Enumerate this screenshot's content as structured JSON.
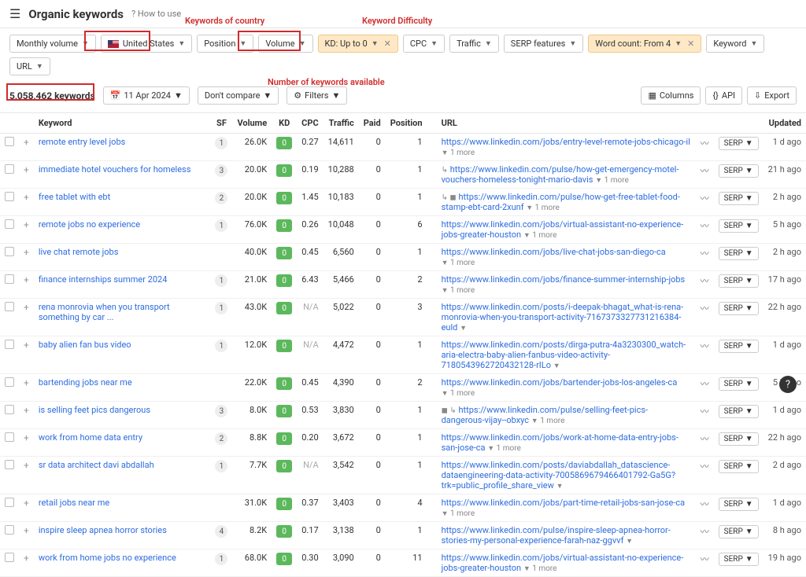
{
  "header": {
    "title": "Organic keywords",
    "how": "How to use"
  },
  "filters": {
    "volume_period": "Monthly volume",
    "country": "United States",
    "position": "Position",
    "volume": "Volume",
    "kd": "KD: Up to 0",
    "cpc": "CPC",
    "traffic": "Traffic",
    "serp": "SERP features",
    "wordcount": "Word count: From 4",
    "keyword": "Keyword",
    "url": "URL"
  },
  "bar": {
    "count": "5,058,462 keywords",
    "date": "11 Apr 2024",
    "compare": "Don't compare",
    "filters_btn": "Filters",
    "columns": "Columns",
    "api": "API",
    "export": "Export"
  },
  "cols": {
    "kw": "Keyword",
    "sf": "SF",
    "vol": "Volume",
    "kd": "KD",
    "cpc": "CPC",
    "traffic": "Traffic",
    "paid": "Paid",
    "pos": "Position",
    "url": "URL",
    "upd": "Updated",
    "serp": "SERP"
  },
  "more_label": "1 more",
  "annot": {
    "country": "Keywords of country",
    "kd": "Keyword Difficulty",
    "count": "Number of keywords available"
  },
  "rows": [
    {
      "kw": "remote entry level jobs",
      "sf": "1",
      "vol": "26.0K",
      "kd": "0",
      "cpc": "0.27",
      "traffic": "14,611",
      "paid": "0",
      "pos": "1",
      "url": "https://www.linkedin.com/jobs/entry-level-remote-jobs-chicago-il",
      "more": true,
      "upd": "1 d ago"
    },
    {
      "kw": "immediate hotel vouchers for homeless",
      "sf": "3",
      "vol": "20.0K",
      "kd": "0",
      "cpc": "0.19",
      "traffic": "10,288",
      "paid": "0",
      "pos": "1",
      "url": "https://www.linkedin.com/pulse/how-get-emergency-motel-vouchers-homeless-tonight-mario-davis",
      "more": true,
      "upd": "21 h ago",
      "pre": "↳"
    },
    {
      "kw": "free tablet with ebt",
      "sf": "2",
      "vol": "20.0K",
      "kd": "0",
      "cpc": "1.45",
      "traffic": "10,183",
      "paid": "0",
      "pos": "1",
      "url": "https://www.linkedin.com/pulse/how-get-free-tablet-food-stamp-ebt-card-2xunf",
      "more": true,
      "upd": "2 h ago",
      "pre": "↳ ◼"
    },
    {
      "kw": "remote jobs no experience",
      "sf": "1",
      "vol": "76.0K",
      "kd": "0",
      "cpc": "0.26",
      "traffic": "10,048",
      "paid": "0",
      "pos": "6",
      "url": "https://www.linkedin.com/jobs/virtual-assistant-no-experience-jobs-greater-houston",
      "more": true,
      "upd": "5 h ago"
    },
    {
      "kw": "live chat remote jobs",
      "sf": "",
      "vol": "40.0K",
      "kd": "0",
      "cpc": "0.45",
      "traffic": "6,560",
      "paid": "0",
      "pos": "1",
      "url": "https://www.linkedin.com/jobs/live-chat-jobs-san-diego-ca",
      "more": true,
      "upd": "2 h ago"
    },
    {
      "kw": "finance internships summer 2024",
      "sf": "1",
      "vol": "21.0K",
      "kd": "0",
      "cpc": "6.43",
      "traffic": "5,466",
      "paid": "0",
      "pos": "2",
      "url": "https://www.linkedin.com/jobs/finance-summer-internship-jobs",
      "more": true,
      "upd": "17 h ago"
    },
    {
      "kw": "rena monrovia when you transport something by car ...",
      "sf": "1",
      "vol": "43.0K",
      "kd": "0",
      "cpc": "N/A",
      "traffic": "5,022",
      "paid": "0",
      "pos": "3",
      "url": "https://www.linkedin.com/posts/i-deepak-bhagat_what-is-rena-monrovia-when-you-transport-activity-7167373327731216384-euld",
      "more": false,
      "upd": "22 h ago"
    },
    {
      "kw": "baby alien fan bus video",
      "sf": "1",
      "vol": "12.0K",
      "kd": "0",
      "cpc": "N/A",
      "traffic": "4,472",
      "paid": "0",
      "pos": "1",
      "url": "https://www.linkedin.com/posts/dirga-putra-4a3230300_watch-aria-electra-baby-alien-fanbus-video-activity-7180543962720432128-rILo",
      "more": false,
      "upd": "1 d ago"
    },
    {
      "kw": "bartending jobs near me",
      "sf": "",
      "vol": "22.0K",
      "kd": "0",
      "cpc": "0.45",
      "traffic": "4,390",
      "paid": "0",
      "pos": "2",
      "url": "https://www.linkedin.com/jobs/bartender-jobs-los-angeles-ca",
      "more": true,
      "upd": "5 h ago"
    },
    {
      "kw": "is selling feet pics dangerous",
      "sf": "3",
      "vol": "8.0K",
      "kd": "0",
      "cpc": "0.53",
      "traffic": "3,830",
      "paid": "0",
      "pos": "1",
      "url": "https://www.linkedin.com/pulse/selling-feet-pics-dangerous-vijay--obxyc",
      "more": true,
      "upd": "1 d ago",
      "pre": "◼ ↳"
    },
    {
      "kw": "work from home data entry",
      "sf": "2",
      "vol": "8.8K",
      "kd": "0",
      "cpc": "0.20",
      "traffic": "3,672",
      "paid": "0",
      "pos": "1",
      "url": "https://www.linkedin.com/jobs/work-at-home-data-entry-jobs-san-jose-ca",
      "more": true,
      "upd": "22 h ago"
    },
    {
      "kw": "sr data architect davi abdallah",
      "sf": "1",
      "vol": "7.7K",
      "kd": "0",
      "cpc": "N/A",
      "traffic": "3,542",
      "paid": "0",
      "pos": "1",
      "url": "https://www.linkedin.com/posts/daviabdallah_datascience-dataengineering-data-activity-7005869679466401792-Ga5G?trk=public_profile_share_view",
      "more": false,
      "upd": "2 d ago"
    },
    {
      "kw": "retail jobs near me",
      "sf": "",
      "vol": "31.0K",
      "kd": "0",
      "cpc": "0.37",
      "traffic": "3,403",
      "paid": "0",
      "pos": "4",
      "url": "https://www.linkedin.com/jobs/part-time-retail-jobs-san-jose-ca",
      "more": true,
      "upd": "1 d ago"
    },
    {
      "kw": "inspire sleep apnea horror stories",
      "sf": "4",
      "vol": "8.2K",
      "kd": "0",
      "cpc": "0.17",
      "traffic": "3,138",
      "paid": "0",
      "pos": "1",
      "url": "https://www.linkedin.com/pulse/inspire-sleep-apnea-horror-stories-my-personal-experience-farah-naz-ggvvf",
      "more": false,
      "upd": "8 h ago"
    },
    {
      "kw": "work from home jobs no experience",
      "sf": "1",
      "vol": "68.0K",
      "kd": "0",
      "cpc": "0.30",
      "traffic": "3,090",
      "paid": "0",
      "pos": "11",
      "url": "https://www.linkedin.com/jobs/virtual-assistant-no-experience-jobs-greater-houston",
      "more": true,
      "upd": "19 h ago"
    }
  ]
}
